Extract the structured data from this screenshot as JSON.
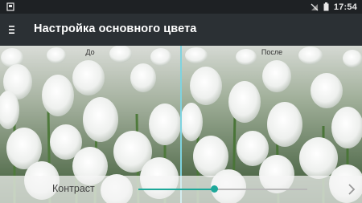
{
  "status": {
    "time": "17:54"
  },
  "header": {
    "title": "Настройка основного цвета"
  },
  "compare": {
    "before_label": "До",
    "after_label": "После"
  },
  "control": {
    "label": "Контраст",
    "slider_value_fraction": 0.45
  },
  "colors": {
    "accent": "#1ea89a",
    "divider": "#7fd3df",
    "appbar": "#2b3034"
  },
  "icons": {
    "menu": "menu-icon",
    "next": "chevron-right-icon",
    "sd": "sd-card-icon",
    "battery": "battery-icon",
    "signal": "no-signal-icon"
  }
}
